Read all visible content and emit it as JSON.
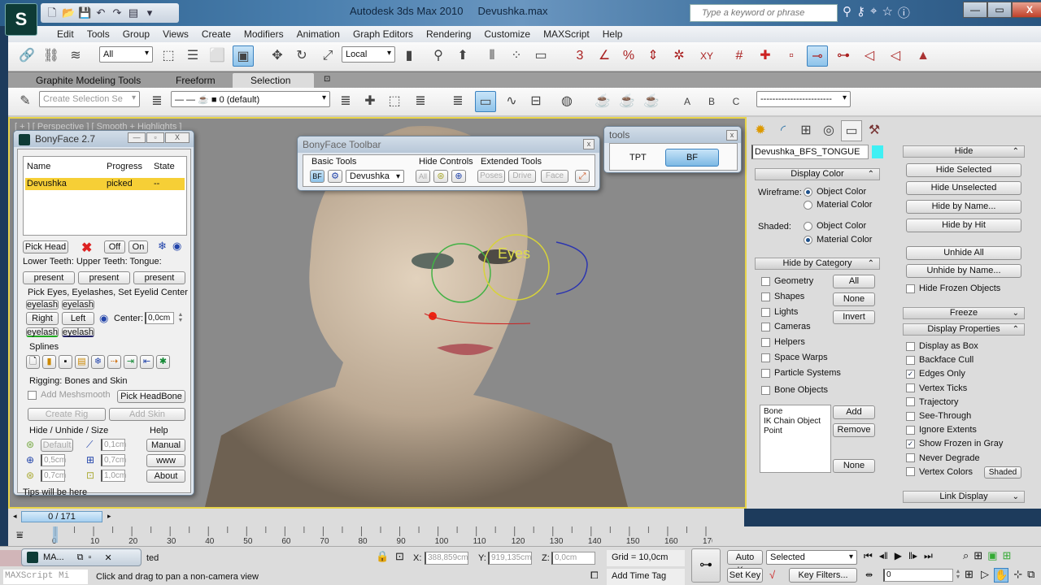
{
  "window": {
    "app_title": "Autodesk 3ds Max  2010",
    "file_name": "Devushka.max",
    "search_placeholder": "Type a keyword or phrase",
    "min_label": "—",
    "max_label": "▭",
    "close_label": "X"
  },
  "menu": [
    "Edit",
    "Tools",
    "Group",
    "Views",
    "Create",
    "Modifiers",
    "Animation",
    "Graph Editors",
    "Rendering",
    "Customize",
    "MAXScript",
    "Help"
  ],
  "toolbar": {
    "selection_filter": "All",
    "reference_coord": "Local",
    "snap_labels": [
      "3",
      "%",
      "XY"
    ]
  },
  "ribbon": {
    "tabs": [
      "Graphite Modeling Tools",
      "Freeform",
      "Selection"
    ],
    "active_tab": "Selection"
  },
  "toolbar2": {
    "selection_set_placeholder": "Create Selection Se",
    "layer": "0 (default)",
    "named_set": "------------------------",
    "teapot_labels": [
      "A",
      "B",
      "C"
    ]
  },
  "viewport": {
    "label": "[ + ] [ Perspective ] [ Smooth + Highlights ]",
    "eyes_label": "Eyes"
  },
  "bonyface": {
    "title": "BonyFace 2.7",
    "columns": [
      "Name",
      "Progress",
      "State"
    ],
    "rows": [
      {
        "name": "Devushka",
        "progress": "picked",
        "state": "--"
      }
    ],
    "pick_head": "Pick Head",
    "off": "Off",
    "on": "On",
    "teeth_label": "Lower Teeth:  Upper Teeth:  Tongue:",
    "present": [
      "present",
      "present",
      "present"
    ],
    "eyes_section": "Pick Eyes, Eyelashes, Set Eyelid Center",
    "eyelash": "eyelash",
    "right": "Right",
    "left": "Left",
    "center_label": "Center:",
    "center_value": "0,0cm",
    "splines_label": "Splines",
    "rigging_label": "Rigging: Bones and Skin",
    "add_meshsmooth": "Add Meshsmooth",
    "pick_headbone": "Pick HeadBone",
    "create_rig": "Create Rig",
    "add_skin": "Add Skin",
    "hide_section": "Hide / Unhide / Size",
    "default_btn": "Default",
    "sizes": [
      "0,1cm",
      "0,5cm",
      "0,7cm",
      "0,7cm",
      "1,0cm"
    ],
    "help_label": "Help",
    "manual": "Manual",
    "www": "www",
    "about": "About",
    "tips": "Tips will be here"
  },
  "bf_toolbar": {
    "title": "BonyFace Toolbar",
    "basic_tools": "Basic Tools",
    "bf": "BF",
    "character": "Devushka",
    "hide_controls": "Hide Controls",
    "all": "All",
    "extended_tools": "Extended Tools",
    "poses": "Poses",
    "drive": "Drive",
    "face": "Face"
  },
  "tools_dlg": {
    "title": "tools",
    "tpt": "TPT",
    "bf": "BF"
  },
  "command_panel": {
    "object_name": "Devushka_BFS_TONGUE",
    "object_color": "#3ff0f4",
    "display_color": {
      "header": "Display Color",
      "wireframe_label": "Wireframe:",
      "shaded_label": "Shaded:",
      "object_color": "Object Color",
      "material_color": "Material Color",
      "wireframe_selected": "Object Color",
      "shaded_selected": "Material Color"
    },
    "hide_by_category": {
      "header": "Hide by Category",
      "items": [
        "Geometry",
        "Shapes",
        "Lights",
        "Cameras",
        "Helpers",
        "Space Warps",
        "Particle Systems",
        "Bone Objects"
      ],
      "all": "All",
      "none": "None",
      "invert": "Invert",
      "list": [
        "Bone",
        "IK Chain Object",
        "Point"
      ],
      "add": "Add",
      "remove": "Remove",
      "none2": "None"
    },
    "hide": {
      "header": "Hide",
      "buttons": [
        "Hide Selected",
        "Hide Unselected",
        "Hide by Name...",
        "Hide by Hit",
        "Unhide All",
        "Unhide by Name..."
      ],
      "hide_frozen": "Hide Frozen Objects"
    },
    "freeze_header": "Freeze",
    "display_properties": {
      "header": "Display Properties",
      "items": [
        {
          "label": "Display as Box",
          "checked": false
        },
        {
          "label": "Backface Cull",
          "checked": false
        },
        {
          "label": "Edges Only",
          "checked": true
        },
        {
          "label": "Vertex Ticks",
          "checked": false
        },
        {
          "label": "Trajectory",
          "checked": false
        },
        {
          "label": "See-Through",
          "checked": false
        },
        {
          "label": "Ignore Extents",
          "checked": false
        },
        {
          "label": "Show Frozen in Gray",
          "checked": true
        },
        {
          "label": "Never Degrade",
          "checked": false
        },
        {
          "label": "Vertex Colors",
          "checked": false
        }
      ],
      "shaded": "Shaded"
    },
    "link_display_header": "Link Display"
  },
  "timeline": {
    "frame_label": "0 / 171",
    "current_frame": 0,
    "total_frames": 171,
    "ticks": [
      "0",
      "10",
      "20",
      "30",
      "40",
      "50",
      "60",
      "70",
      "80",
      "90",
      "100",
      "110",
      "120",
      "130",
      "140",
      "150",
      "160",
      "170"
    ]
  },
  "status": {
    "maxscript_label": "MA...",
    "maxscript_mini": "MAXScript Mi",
    "selected_text": "ted",
    "prompt": "Click and drag to pan a non-camera view",
    "x_label": "X:",
    "x_value": "388,859cm",
    "y_label": "Y:",
    "y_value": "919,135cm",
    "z_label": "Z:",
    "z_value": "0,0cm",
    "grid": "Grid = 10,0cm",
    "add_time_tag": "Add Time Tag",
    "auto_key": "Auto Key",
    "set_key": "Set Key",
    "key_mode": "Selected",
    "key_filters": "Key Filters...",
    "frame_field": "0"
  }
}
